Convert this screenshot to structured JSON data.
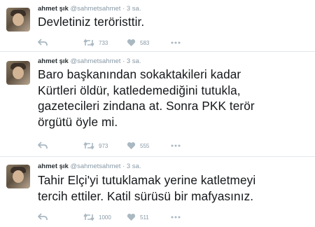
{
  "tweets": [
    {
      "author_name": "ahmet şık",
      "handle": "@sahmetsahmet",
      "separator": "·",
      "time": "3 sa.",
      "text": "Devletiniz teröristtir.",
      "retweets": "733",
      "likes": "583"
    },
    {
      "author_name": "ahmet şık",
      "handle": "@sahmetsahmet",
      "separator": "·",
      "time": "3 sa.",
      "text": "Baro başkanından sokaktakileri kadar\nKürtleri öldür, katledemediğini tutukla,\ngazetecileri zindana at. Sonra PKK terör\nörgütü öyle mi.",
      "retweets": "973",
      "likes": "555"
    },
    {
      "author_name": "ahmet şık",
      "handle": "@sahmetsahmet",
      "separator": "·",
      "time": "3 sa.",
      "text": "Tahir Elçi'yi tutuklamak yerine katletmeyi\ntercih ettiler. Katil sürüsü bir mafyasınız.",
      "retweets": "1000",
      "likes": "511"
    }
  ],
  "icons": {
    "reply": "reply-icon",
    "retweet": "retweet-icon",
    "like": "heart-icon",
    "more": "more-icon"
  },
  "colors": {
    "text": "#14171a",
    "muted": "#8899a6",
    "icon": "#aab8c2",
    "divider": "#e1e8ed"
  }
}
